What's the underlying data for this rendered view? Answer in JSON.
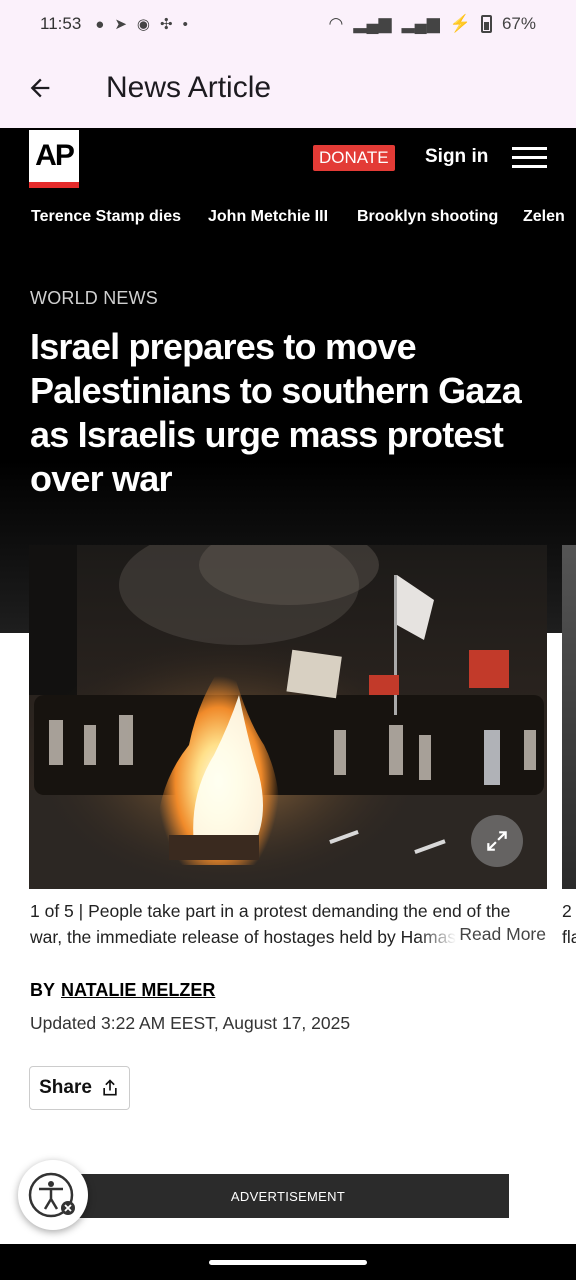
{
  "status_bar": {
    "time": "11:53",
    "battery": "67%",
    "notification_icons": [
      "chat-bubble-icon",
      "telegram-icon",
      "discord-icon",
      "fan-icon",
      "dot-icon"
    ],
    "system_icons": [
      "wifi-icon",
      "signal-icon",
      "signal-icon",
      "charging-icon",
      "battery-icon"
    ]
  },
  "app_bar": {
    "title": "News Article"
  },
  "site_nav": {
    "logo": "AP",
    "donate_label": "DONATE",
    "signin_label": "Sign in"
  },
  "trending": [
    "Terence Stamp dies",
    "John Metchie III",
    "Brooklyn shooting",
    "Zelen"
  ],
  "article": {
    "section": "WORLD NEWS",
    "headline": "Israel prepares to move Palestinians to southern Gaza as Israelis urge mass protest over war",
    "caption_counter": "1 of 5 |",
    "caption_text": "People take part in a protest demanding the end of the war, the immediate release of hostages held by Hamas in th",
    "caption_next_counter": "2",
    "caption_next_fragment": "fla",
    "read_more_label": "Read More",
    "byline_prefix": "BY",
    "author": "NATALIE MELZER",
    "updated": "Updated 3:22 AM EEST, August 17, 2025",
    "share_label": "Share"
  },
  "ad": {
    "label": "ADVERTISEMENT"
  },
  "colors": {
    "accent_red": "#e33b36",
    "nav_bg": "#000000",
    "appbar_bg": "#fbf1fb"
  }
}
